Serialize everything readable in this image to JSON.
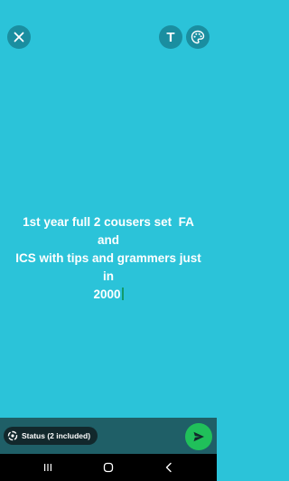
{
  "status_text": "1st year full 2 cousers set  FA and\nICS with tips and grammers just in\n2000",
  "toolbar": {
    "close_icon": "close-icon",
    "text_tool_label": "T",
    "palette_icon": "palette-icon"
  },
  "audience": {
    "label": "Status (2 included)",
    "icon": "status-ring-icon"
  },
  "send": {
    "icon": "send-icon"
  },
  "navigation": {
    "recent_icon": "recent-apps-icon",
    "home_icon": "home-icon",
    "back_icon": "back-icon"
  },
  "colors": {
    "background": "#2bc3d9",
    "send_button": "#20c05a",
    "cursor": "#129b6b"
  }
}
